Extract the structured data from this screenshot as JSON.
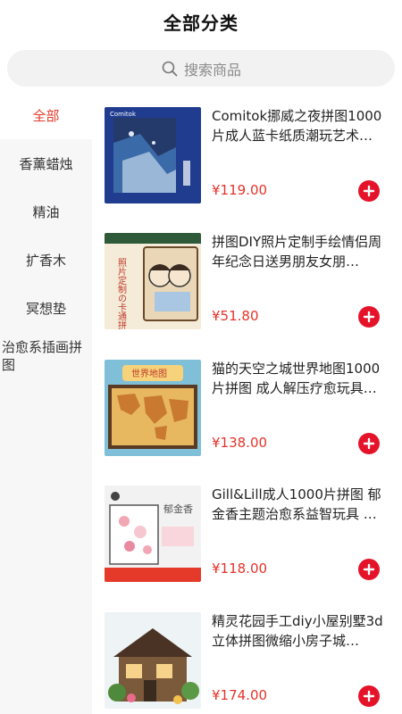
{
  "header": {
    "title": "全部分类"
  },
  "search": {
    "placeholder": "搜索商品"
  },
  "sidebar": {
    "items": [
      {
        "label": "全部",
        "active": true
      },
      {
        "label": "香薰蜡烛",
        "active": false
      },
      {
        "label": "精油",
        "active": false
      },
      {
        "label": "扩香木",
        "active": false
      },
      {
        "label": "冥想垫",
        "active": false
      },
      {
        "label": "治愈系插画拼图",
        "active": false
      }
    ]
  },
  "products": [
    {
      "name": "Comitok挪威之夜拼图1000片成人蓝卡纸质潮玩艺术…",
      "price": "¥119.00",
      "image_text": "Comitok"
    },
    {
      "name": "拼图DIY照片定制手绘情侣周年纪念日送男朋友女朋…",
      "price": "¥51.80",
      "image_text": "照片定制の卡通拼图"
    },
    {
      "name": "猫的天空之城世界地图1000片拼图 成人解压疗愈玩具…",
      "price": "¥138.00",
      "image_text": "世界地图"
    },
    {
      "name": "Gill&Lill成人1000片拼图 郁金香主题治愈系益智玩具 …",
      "price": "¥118.00",
      "image_text": "郁金香"
    },
    {
      "name": "精灵花园手工diy小屋别墅3d立体拼图微缩小房子城…",
      "price": "¥174.00",
      "image_text": ""
    }
  ],
  "colors": {
    "accent": "#e5332a",
    "add_button": "#e5132a",
    "sidebar_bg": "#f7f7f7"
  }
}
